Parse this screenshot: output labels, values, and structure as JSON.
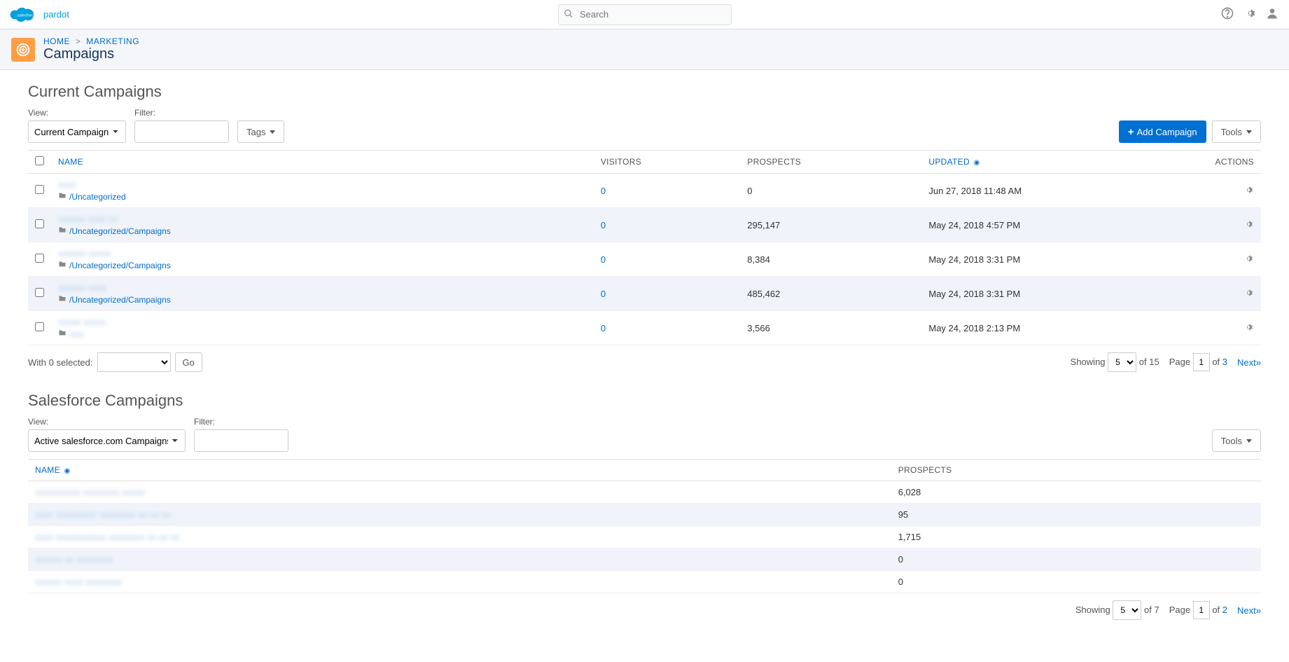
{
  "header": {
    "brand_suffix": "pardot",
    "search_placeholder": "Search"
  },
  "subheader": {
    "breadcrumb_home": "HOME",
    "breadcrumb_marketing": "MARKETING",
    "page_title": "Campaigns"
  },
  "current_campaigns": {
    "section_title": "Current Campaigns",
    "view_label": "View:",
    "filter_label": "Filter:",
    "view_value": "Current Campaigns",
    "tags_button": "Tags",
    "add_button": "Add Campaign",
    "tools_button": "Tools",
    "columns": {
      "name": "NAME",
      "visitors": "VISITORS",
      "prospects": "PROSPECTS",
      "updated": "UPDATED",
      "actions": "ACTIONS"
    },
    "rows": [
      {
        "name_blur": "xxxx",
        "path": "/Uncategorized",
        "visitors": "0",
        "prospects": "0",
        "updated": "Jun 27, 2018 11:48 AM"
      },
      {
        "name_blur": "xxxxxx xxxx xx",
        "path": "/Uncategorized/Campaigns",
        "visitors": "0",
        "prospects": "295,147",
        "updated": "May 24, 2018 4:57 PM"
      },
      {
        "name_blur": "xxxxxx xxxxx",
        "path": "/Uncategorized/Campaigns",
        "visitors": "0",
        "prospects": "8,384",
        "updated": "May 24, 2018 3:31 PM"
      },
      {
        "name_blur": "xxxxxx xxxx",
        "path": "/Uncategorized/Campaigns",
        "visitors": "0",
        "prospects": "485,462",
        "updated": "May 24, 2018 3:31 PM"
      },
      {
        "name_blur": "xxxxx xxxxx",
        "path": "/xxx",
        "path_blur": true,
        "visitors": "0",
        "prospects": "3,566",
        "updated": "May 24, 2018 2:13 PM"
      }
    ],
    "footer": {
      "with_selected_prefix": "With 0 selected:",
      "go_button": "Go",
      "showing_label": "Showing",
      "showing_value": "5",
      "of_total_label": "of 15",
      "page_label": "Page",
      "page_value": "1",
      "page_total_label": "of",
      "page_total": "3",
      "next_label": "Next»"
    }
  },
  "sf_campaigns": {
    "section_title": "Salesforce Campaigns",
    "view_label": "View:",
    "filter_label": "Filter:",
    "view_value": "Active salesforce.com Campaigns",
    "tools_button": "Tools",
    "columns": {
      "name": "NAME",
      "prospects": "PROSPECTS"
    },
    "rows": [
      {
        "name_blur": "xxxxxxxxxx xxxxxxxx xxxxx",
        "prospects": "6,028"
      },
      {
        "name_blur": "xxxx xxxxxxxxx xxxxxxxx xx xx xx",
        "prospects": "95"
      },
      {
        "name_blur": "xxxx xxxxxxxxxxx xxxxxxxx xx xx xx",
        "prospects": "1,715"
      },
      {
        "name_blur": "xxxxxx xx xxxxxxxx",
        "prospects": "0"
      },
      {
        "name_blur": "xxxxxx xxxx xxxxxxxx",
        "prospects": "0"
      }
    ],
    "footer": {
      "showing_label": "Showing",
      "showing_value": "5",
      "of_total_label": "of 7",
      "page_label": "Page",
      "page_value": "1",
      "page_total_label": "of",
      "page_total": "2",
      "next_label": "Next»"
    }
  }
}
